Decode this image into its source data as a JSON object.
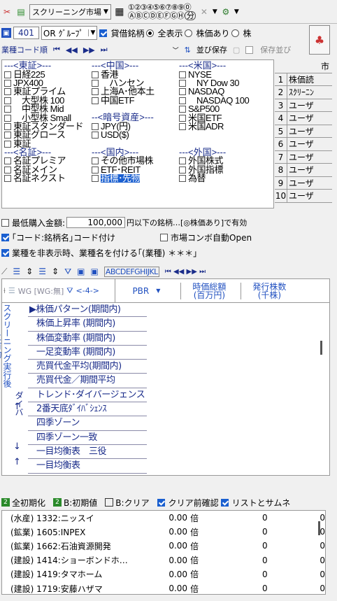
{
  "toolbar1": {
    "screen_select": "スクリーニング市場",
    "num_tabs": "①②③④⑤⑥⑦⑧⑨⓪",
    "alpha_tabs": "ⒶⒷⒸⒹⒺⒻⒼⒽ",
    "minute": "分"
  },
  "toolbar2": {
    "num": "401",
    "group_select": "OR ｸﾞﾙｰﾌﾟ",
    "credit_label": "貸借銘柄",
    "radio_all": "全表示",
    "radio_with": "株価あり",
    "radio_with2": "株"
  },
  "toolbar3": {
    "sort_label": "業種コード順",
    "save_label": "並び保存",
    "save_order": "保存並び"
  },
  "market": {
    "col1": [
      {
        "type": "hdr",
        "text": "---<東証>---"
      },
      {
        "type": "item",
        "text": "日経225",
        "checked": false
      },
      {
        "type": "item",
        "text": "JPX400",
        "checked": false
      },
      {
        "type": "item",
        "text": "東証プライム",
        "checked": false
      },
      {
        "type": "item",
        "text": "大型株 100",
        "checked": false,
        "indent": true
      },
      {
        "type": "item",
        "text": "中型株 Mid",
        "checked": false,
        "indent": true
      },
      {
        "type": "item",
        "text": "小型株 Small",
        "checked": false,
        "indent": true
      },
      {
        "type": "item",
        "text": "東証スタンダード",
        "checked": false
      },
      {
        "type": "item",
        "text": "東証グロース",
        "checked": false
      },
      {
        "type": "item",
        "text": "東証",
        "checked": false
      },
      {
        "type": "hdr",
        "text": "---<名証>---"
      },
      {
        "type": "item",
        "text": "名証プレミア",
        "checked": false
      },
      {
        "type": "item",
        "text": "名証メイン",
        "checked": false
      },
      {
        "type": "item",
        "text": "名証ネクスト",
        "checked": false
      }
    ],
    "col2": [
      {
        "type": "hdr",
        "text": "---<中国>---"
      },
      {
        "type": "item",
        "text": "香港",
        "checked": false
      },
      {
        "type": "item",
        "text": "ハンセン",
        "checked": false,
        "indent": true
      },
      {
        "type": "item",
        "text": "上海A･他本土",
        "checked": false
      },
      {
        "type": "item",
        "text": "中国ETF",
        "checked": false
      },
      {
        "type": "blank",
        "text": ""
      },
      {
        "type": "hdr",
        "text": "--<暗号資産>---"
      },
      {
        "type": "item",
        "text": "JPY(円)",
        "checked": false
      },
      {
        "type": "item",
        "text": "USD($)",
        "checked": false
      },
      {
        "type": "blank",
        "text": ""
      },
      {
        "type": "hdr",
        "text": "---<国内>---"
      },
      {
        "type": "item",
        "text": "その他市場株",
        "checked": false
      },
      {
        "type": "item",
        "text": "ETF･REIT",
        "checked": false
      },
      {
        "type": "item",
        "text": "指標･先物",
        "checked": false,
        "selected": true
      }
    ],
    "col3": [
      {
        "type": "hdr",
        "text": "---<米国>---"
      },
      {
        "type": "item",
        "text": "NYSE",
        "checked": false
      },
      {
        "type": "item",
        "text": "NY Dow 30",
        "checked": false,
        "indent": true
      },
      {
        "type": "item",
        "text": "NASDAQ",
        "checked": false
      },
      {
        "type": "item",
        "text": "NASDAQ 100",
        "checked": false,
        "indent": true
      },
      {
        "type": "item",
        "text": "S&P500",
        "checked": false
      },
      {
        "type": "item",
        "text": "米国ETF",
        "checked": false
      },
      {
        "type": "item",
        "text": "米国ADR",
        "checked": false
      },
      {
        "type": "blank",
        "text": ""
      },
      {
        "type": "blank",
        "text": ""
      },
      {
        "type": "hdr",
        "text": "---<外国>---"
      },
      {
        "type": "item",
        "text": "外国株式",
        "checked": false
      },
      {
        "type": "item",
        "text": "外国指標",
        "checked": false
      },
      {
        "type": "item",
        "text": "為替",
        "checked": false
      }
    ]
  },
  "right_list": {
    "header": "市",
    "rows": [
      {
        "n": "1",
        "t": "株価読"
      },
      {
        "n": "2",
        "t": "ｽｸﾘｰﾆﾝ"
      },
      {
        "n": "3",
        "t": "ユーザ"
      },
      {
        "n": "4",
        "t": "ユーザ"
      },
      {
        "n": "5",
        "t": "ユーザ"
      },
      {
        "n": "6",
        "t": "ユーザ"
      },
      {
        "n": "7",
        "t": "ユーザ"
      },
      {
        "n": "8",
        "t": "ユーザ"
      },
      {
        "n": "9",
        "t": "ユーザ"
      },
      {
        "n": "10",
        "t": "ユーザ"
      }
    ]
  },
  "options": {
    "min_price_label": "最低購入金額:",
    "min_price_value": "100,000",
    "min_price_suffix": "円以下の銘柄…[◎株価あり]で有効",
    "code_name_label": "｢コード:銘柄名｣コード付け",
    "combo_auto_label": "市場コンボ自動Open",
    "industry_label": "業種を非表示時、業種名を付ける｢(業種) ＊＊＊｣"
  },
  "grid_toolbar": {
    "letters": "ABCDEFGHIJKL",
    "wg_label": "WG [WG:無]",
    "col_range": "<-4->"
  },
  "grid_header": {
    "pbr": "PBR",
    "sort_arrow": "▼",
    "mcap": "時価総額\n(百万円)",
    "shares": "発行株数\n(千株)"
  },
  "side_labels": {
    "screening": "スクリーニング実行後に有効",
    "divers": "ダイバ"
  },
  "indicator_list": [
    "株価パターン(期間内)",
    "株価上昇率 (期間内)",
    "株価変動率 (期間内)",
    "一足変動率 (期間内)",
    "売買代金平均(期間内)",
    "売買代金／期間平均",
    "トレンド･ダイバージェンス",
    "2番天底ﾀﾞｲﾊﾞｼｪﾝｽ",
    "四季ゾーン",
    "四季ゾーン一致",
    "一目均衡表　三役",
    "一目均衡表"
  ],
  "bottom_toolbar": {
    "all_reset": "全初期化",
    "b_reset": "B:初期値",
    "b_clear": "B:クリア",
    "confirm": "クリア前確認",
    "list_thumb": "リストとサムネ"
  },
  "stocks": [
    {
      "name": "(水産) 1332:ニッスイ",
      "pbr": "0.00",
      "unit": "倍",
      "mcap": "0",
      "shares": "0"
    },
    {
      "name": "(鉱業) 1605:INPEX",
      "pbr": "0.00",
      "unit": "倍",
      "mcap": "0",
      "shares": "0"
    },
    {
      "name": "(鉱業) 1662:石油資源開発",
      "pbr": "0.00",
      "unit": "倍",
      "mcap": "0",
      "shares": "0"
    },
    {
      "name": "(建設) 1414:ショーボンドホ…",
      "pbr": "0.00",
      "unit": "倍",
      "mcap": "0",
      "shares": "0"
    },
    {
      "name": "(建設) 1419:タマホーム",
      "pbr": "0.00",
      "unit": "倍",
      "mcap": "0",
      "shares": "0"
    },
    {
      "name": "(建設) 1719:安藤ハザマ",
      "pbr": "0.00",
      "unit": "倍",
      "mcap": "0",
      "shares": "0"
    }
  ]
}
